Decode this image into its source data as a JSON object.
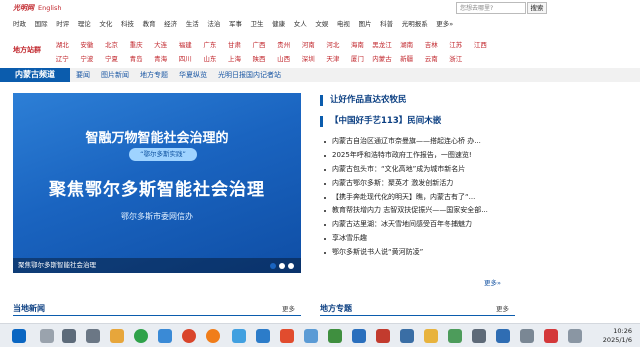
{
  "header": {
    "logo_text": "光明网",
    "lang_link": "English",
    "search_placeholder": "您想去哪里?",
    "search_button": "搜索"
  },
  "top_nav": [
    "时政",
    "国际",
    "时评",
    "理论",
    "文化",
    "科技",
    "教育",
    "经济",
    "生活",
    "法治",
    "军事",
    "卫生",
    "健康",
    "女人",
    "文娱",
    "电视",
    "图片",
    "科普",
    "光明报系",
    "更多»"
  ],
  "regions": {
    "title": "地方站群",
    "row1": [
      "湖北",
      "安徽",
      "北京",
      "重庆",
      "大连",
      "福建",
      "广东",
      "甘肃",
      "广西",
      "贵州",
      "河南",
      "河北",
      "海南",
      "黑龙江",
      "湖南",
      "吉林",
      "江苏",
      "江西"
    ],
    "row2": [
      "辽宁",
      "宁波",
      "宁夏",
      "青岛",
      "青海",
      "四川",
      "山东",
      "上海",
      "陕西",
      "山西",
      "深圳",
      "天津",
      "厦门",
      "内蒙古",
      "新疆",
      "云南",
      "浙江"
    ]
  },
  "channel": {
    "title": "内蒙古频道",
    "links": [
      "要闻",
      "图片新闻",
      "地方专题",
      "华夏纵览",
      "光明日报国内记者站"
    ]
  },
  "banner": {
    "headline1": "智融万物智能社会治理的",
    "pill": "“鄂尔多斯实践”",
    "headline2": "聚焦鄂尔多斯智能社会治理",
    "source": "鄂尔多斯市委网信办",
    "caption": "聚焦鄂尔多斯智能社会治理"
  },
  "news": {
    "heading": "让好作品直达农牧民",
    "feature": "【中国好手艺113】民间木嵌",
    "items": [
      "内蒙古自治区通辽市奈曼旗——搭起连心桥  办...",
      "2025年呼和浩特市政府工作报告，一图速览!",
      "内蒙古包头市：“文化高地”成为城市新名片",
      "内蒙古鄂尔多斯：聚英才 激发创新活力",
      "【携手奔赴现代化的明天】瞧，内蒙古有了“...",
      "教育帮扶增内力 志智双扶促振兴——国家安全部...",
      "内蒙古达里湖：冰天雪地间感受百年冬捕魅力",
      "享冰雪乐趣",
      "鄂尔多斯说书人说“黄河防凌”"
    ],
    "more": "更多»"
  },
  "sections": {
    "left_title": "当地新闻",
    "left_more": "更多",
    "right_title": "地方专题",
    "right_more": "更多"
  },
  "taskbar": {
    "time": "10:26",
    "date": "2025/1/6"
  },
  "colors": {
    "brand_red": "#c1272d",
    "brand_blue": "#0b5cad"
  }
}
